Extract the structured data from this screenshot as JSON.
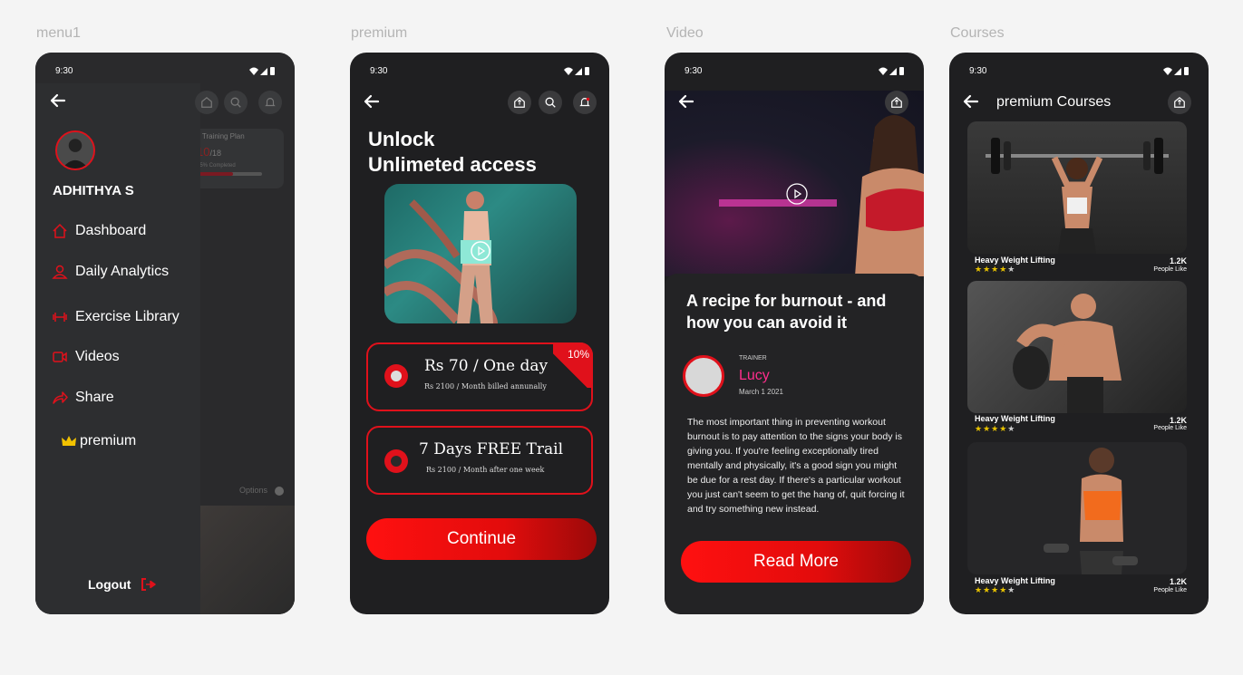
{
  "frames": {
    "menu": "menu1",
    "premium": "premium",
    "video": "Video",
    "courses": "Courses"
  },
  "status": {
    "time": "9:30"
  },
  "menu": {
    "user_name": "ADHITHYA S",
    "items": [
      {
        "label": "Dashboard",
        "icon": "home-icon"
      },
      {
        "label": "Daily Analytics",
        "icon": "user-icon"
      },
      {
        "label": "Exercise Library",
        "icon": "dumbbell-icon"
      },
      {
        "label": "Videos",
        "icon": "video-icon"
      },
      {
        "label": "Share",
        "icon": "share-icon"
      },
      {
        "label": "premium",
        "icon": "crown-icon"
      }
    ],
    "logout": "Logout",
    "background": {
      "plan_title": "ly Training Plan",
      "plan_count": "10",
      "plan_total": "/18",
      "plan_completed": "55% Completed",
      "options": "Options"
    }
  },
  "premium": {
    "title_line1": "Unlock",
    "title_line2": "Unlimeted access",
    "plans": [
      {
        "title": "Rs 70 / One day",
        "subtitle": "Rs 2100 / Month billed annunally",
        "badge": "10%"
      },
      {
        "title": "7 Days FREE Trail",
        "subtitle": "Rs 2100 / Month after one week"
      }
    ],
    "cta": "Continue"
  },
  "video": {
    "title": "A recipe for burnout - and how you can avoid it",
    "trainer_label": "TRAINER",
    "trainer_name": "Lucy",
    "date": "March 1 2021",
    "body": "The most important thing in preventing workout burnout is to pay attention to the signs your body is giving you. If you're feeling exceptionally tired mentally and physically, it's a good sign you might be due for a rest day. If there's a particular workout you just can't seem to get the hang of, quit forcing it and try something new instead.",
    "cta": "Read More"
  },
  "courses": {
    "title": "premium Courses",
    "items": [
      {
        "name": "Heavy Weight Lifting",
        "likes": "1.2K",
        "likes_label": "People Like",
        "rating": 4
      },
      {
        "name": "Heavy Weight Lifting",
        "likes": "1.2K",
        "likes_label": "People Like",
        "rating": 4
      },
      {
        "name": "Heavy Weight Lifting",
        "likes": "1.2K",
        "likes_label": "People Like",
        "rating": 4
      }
    ]
  },
  "colors": {
    "accent": "#e0111b",
    "phone_bg": "#1f1f21",
    "trainer": "#ff2d8c",
    "star": "#e8c200"
  }
}
